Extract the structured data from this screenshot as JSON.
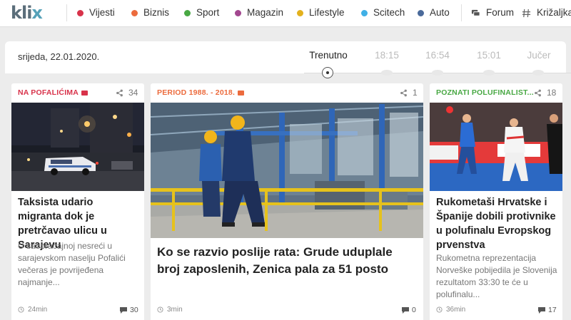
{
  "brand": {
    "logo_main": "kli",
    "logo_x": "x"
  },
  "nav": {
    "items": [
      {
        "label": "Vijesti",
        "color": "#d8324a"
      },
      {
        "label": "Biznis",
        "color": "#ec6b3d"
      },
      {
        "label": "Sport",
        "color": "#48a843"
      },
      {
        "label": "Magazin",
        "color": "#a2478f"
      },
      {
        "label": "Lifestyle",
        "color": "#e3b11d"
      },
      {
        "label": "Scitech",
        "color": "#40b0e6"
      },
      {
        "label": "Auto",
        "color": "#4a6a9a"
      }
    ],
    "forum": "Forum",
    "krizaljka": "Križaljka"
  },
  "timeline": {
    "date": "srijeda, 22.01.2020.",
    "slots": [
      "Trenutno",
      "18:15",
      "16:54",
      "15:01",
      "Jučer"
    ]
  },
  "cards": [
    {
      "category": "NA POFALIĆIMA",
      "category_color": "#d8324a",
      "shares": "34",
      "title": "Taksista udario migranta dok je pretrčavao ulicu u Sarajevu",
      "desc": "U saobraćajnoj nesreći u sarajevskom naselju Pofalići večeras je povrijeđena najmanje...",
      "time": "24min",
      "comments": "30"
    },
    {
      "category": "PERIOD 1988. - 2018.",
      "category_color": "#ec6b3d",
      "shares": "1",
      "title": "Ko se razvio poslije rata: Grude uduplale broj zaposlenih, Zenica pala za 51 posto",
      "time": "3min",
      "comments": "0"
    },
    {
      "category": "POZNATI POLUFINALIST...",
      "category_color": "#48a843",
      "shares": "18",
      "title": "Rukometaši Hrvatske i Španije dobili protivnike u polufinalu Evropskog prvenstva",
      "desc": "Rukometna reprezentacija Norveške pobijedila je Slovenija rezultatom 33:30 te će u polufinalu...",
      "time": "36min",
      "comments": "17"
    }
  ]
}
